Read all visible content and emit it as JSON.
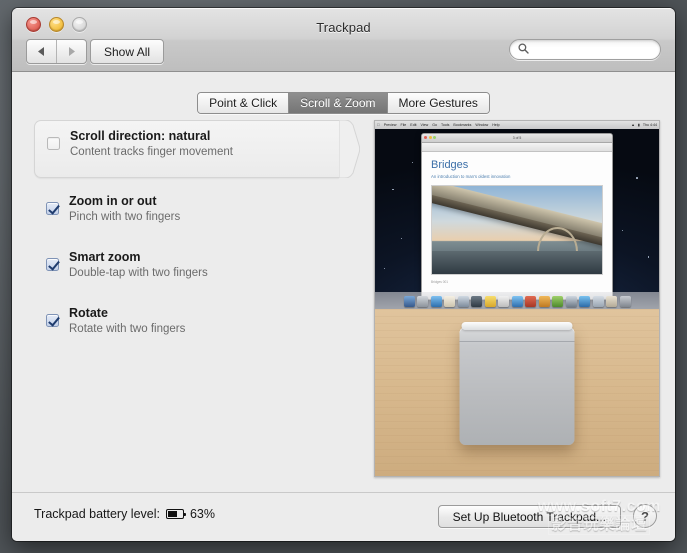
{
  "window": {
    "title": "Trackpad",
    "traffic_lights": [
      {
        "name": "close",
        "color": "#e06055"
      },
      {
        "name": "minimize",
        "color": "#f2be3e"
      },
      {
        "name": "zoom",
        "color": "#d8d8d8"
      }
    ]
  },
  "toolbar": {
    "back_icon": "back-arrow-icon",
    "forward_icon": "forward-arrow-icon",
    "show_all_label": "Show All",
    "search": {
      "icon": "search-icon",
      "value": "",
      "placeholder": ""
    }
  },
  "tabs": [
    {
      "label": "Point & Click",
      "selected": false
    },
    {
      "label": "Scroll & Zoom",
      "selected": true
    },
    {
      "label": "More Gestures",
      "selected": false
    }
  ],
  "options": [
    {
      "id": "scroll-direction",
      "title": "Scroll direction: natural",
      "subtitle": "Content tracks finger movement",
      "checked": false,
      "highlighted": true
    },
    {
      "id": "zoom-in-or-out",
      "title": "Zoom in or out",
      "subtitle": "Pinch with two fingers",
      "checked": true,
      "highlighted": false
    },
    {
      "id": "smart-zoom",
      "title": "Smart zoom",
      "subtitle": "Double-tap with two fingers",
      "checked": true,
      "highlighted": false
    },
    {
      "id": "rotate",
      "title": "Rotate",
      "subtitle": "Rotate with two fingers",
      "checked": true,
      "highlighted": false
    }
  ],
  "demo": {
    "name": "gesture-demo-video",
    "preview_window": {
      "title": "3 of 5",
      "heading": "Bridges",
      "subheading": "An introduction to man's oldest innovation",
      "caption": "Bridges 001"
    }
  },
  "bottom_bar": {
    "battery_label": "Trackpad battery level:",
    "battery_icon": "battery-icon",
    "battery_percent": "63%",
    "battery_fill_ratio": 63,
    "setup_button_label": "Set Up Bluetooth Trackpad...",
    "help_button_label": "?"
  },
  "watermark": {
    "url": "www.soft7.com",
    "text": "影音玩樂論壇"
  },
  "colors": {
    "selected_tab_bg": "#7f7f7f",
    "checkbox_check": "#1f3c6e",
    "checkbox_fill": "#c3d1ea",
    "window_bg": "#ececec",
    "desktop_bg": "#55595d"
  }
}
